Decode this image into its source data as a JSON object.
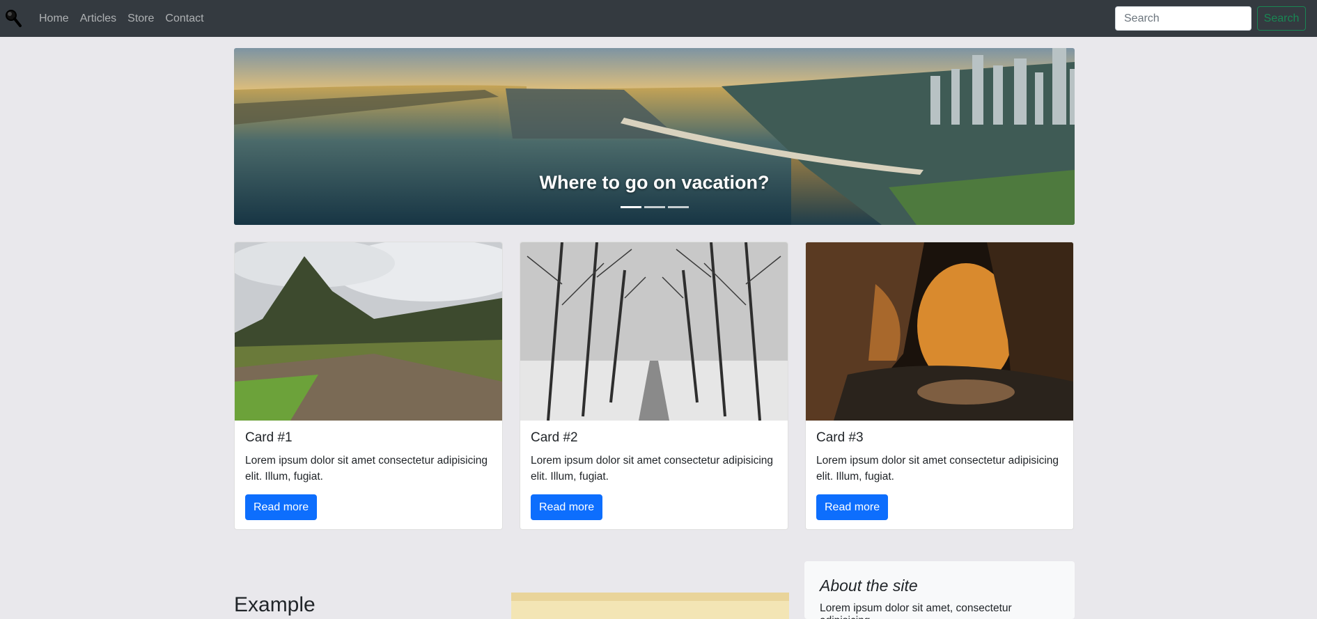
{
  "navbar": {
    "links": [
      {
        "label": "Home"
      },
      {
        "label": "Articles"
      },
      {
        "label": "Store"
      },
      {
        "label": "Contact"
      }
    ],
    "search_placeholder": "Search",
    "search_button": "Search"
  },
  "carousel": {
    "caption": "Where to go on vacation?",
    "slide_count": 3,
    "active_index": 0
  },
  "cards": [
    {
      "title": "Card #1",
      "text": "Lorem ipsum dolor sit amet consectetur adipisicing elit. Illum, fugiat.",
      "button": "Read more"
    },
    {
      "title": "Card #2",
      "text": "Lorem ipsum dolor sit amet consectetur adipisicing elit. Illum, fugiat.",
      "button": "Read more"
    },
    {
      "title": "Card #3",
      "text": "Lorem ipsum dolor sit amet consectetur adipisicing elit. Illum, fugiat.",
      "button": "Read more"
    }
  ],
  "example": {
    "heading": "Example"
  },
  "about": {
    "title": "About the site",
    "text": "Lorem ipsum dolor sit amet, consectetur adipisicing"
  },
  "colors": {
    "navbar_bg": "#343a40",
    "page_bg": "#e9e8ec",
    "primary": "#0d6efd",
    "success": "#198754"
  }
}
